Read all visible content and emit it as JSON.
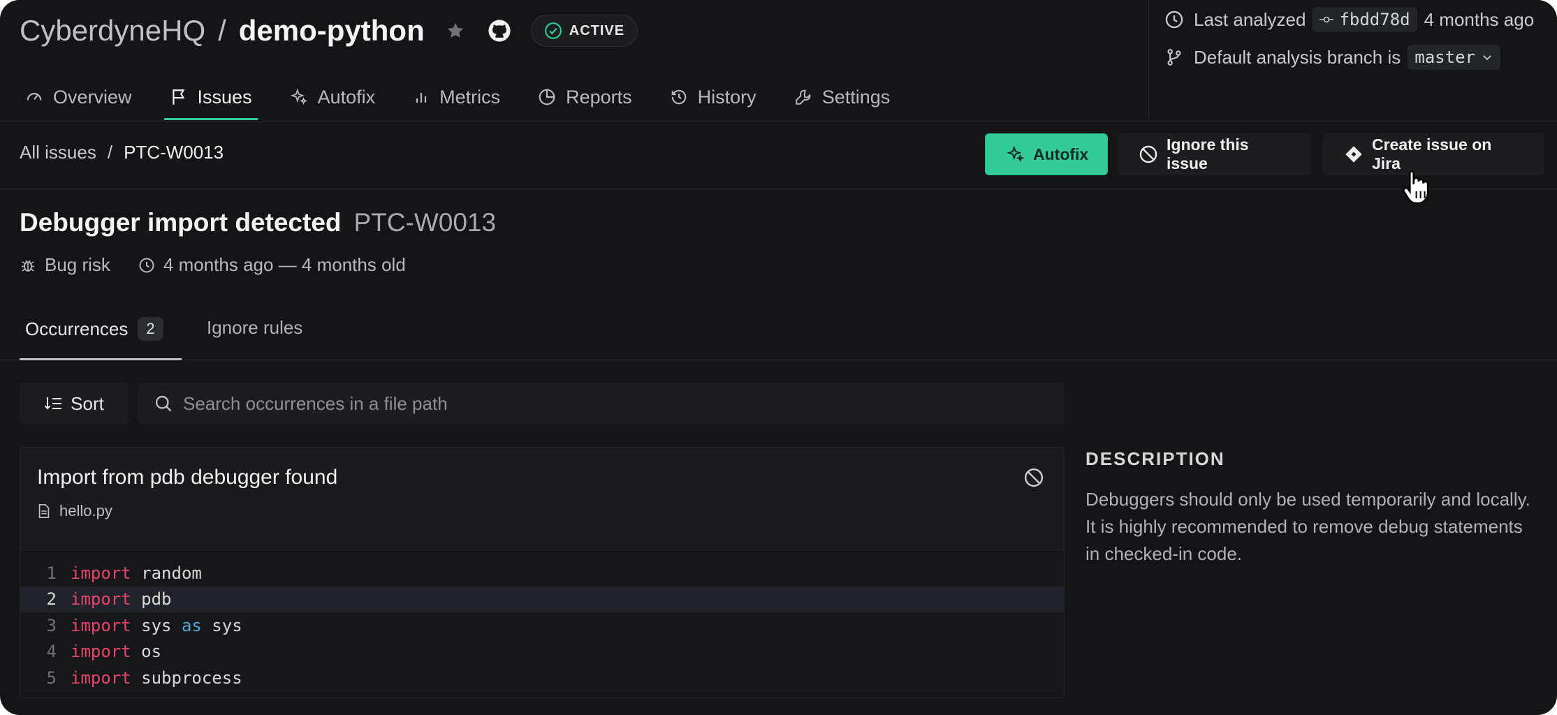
{
  "header": {
    "org": "CyberdyneHQ",
    "separator": "/",
    "repo": "demo-python",
    "status_badge": "ACTIVE",
    "last_analyzed_label": "Last analyzed",
    "commit": "fbdd78d",
    "last_analyzed_time": "4 months ago",
    "branch_label": "Default analysis branch is",
    "branch": "master"
  },
  "tabs": [
    {
      "label": "Overview",
      "icon": "gauge-icon"
    },
    {
      "label": "Issues",
      "icon": "flag-icon",
      "active": true
    },
    {
      "label": "Autofix",
      "icon": "sparkle-icon"
    },
    {
      "label": "Metrics",
      "icon": "bar-chart-icon"
    },
    {
      "label": "Reports",
      "icon": "pie-chart-icon"
    },
    {
      "label": "History",
      "icon": "history-icon"
    },
    {
      "label": "Settings",
      "icon": "wrench-icon"
    }
  ],
  "breadcrumb": {
    "root": "All issues",
    "current": "PTC-W0013"
  },
  "actions": {
    "autofix": "Autofix",
    "ignore": "Ignore this issue",
    "jira": "Create issue on Jira"
  },
  "issue": {
    "title": "Debugger import detected",
    "code": "PTC-W0013",
    "category": "Bug risk",
    "age": "4 months ago — 4 months old"
  },
  "occurrence_tabs": {
    "occurrences": "Occurrences",
    "count": "2",
    "ignore_rules": "Ignore rules"
  },
  "toolbar": {
    "sort": "Sort",
    "search_placeholder": "Search occurrences in a file path"
  },
  "occurrence": {
    "title": "Import from pdb debugger found",
    "file": "hello.py",
    "code_lines": [
      {
        "n": "1",
        "kw": "import",
        "rest": " random"
      },
      {
        "n": "2",
        "kw": "import",
        "rest": " pdb"
      },
      {
        "n": "3",
        "kw": "import",
        "mid": " sys ",
        "kw2": "as",
        "rest": " sys"
      },
      {
        "n": "4",
        "kw": "import",
        "rest": " os"
      },
      {
        "n": "5",
        "kw": "import",
        "rest": " subprocess"
      }
    ]
  },
  "description": {
    "title": "DESCRIPTION",
    "line1": "Debuggers should only be used temporarily and locally.",
    "line2": "It is highly recommended to remove debug statements",
    "line3": "in checked-in code."
  },
  "colors": {
    "accent": "#33cb9a",
    "background": "#141518",
    "keyword": "#e6446a"
  }
}
